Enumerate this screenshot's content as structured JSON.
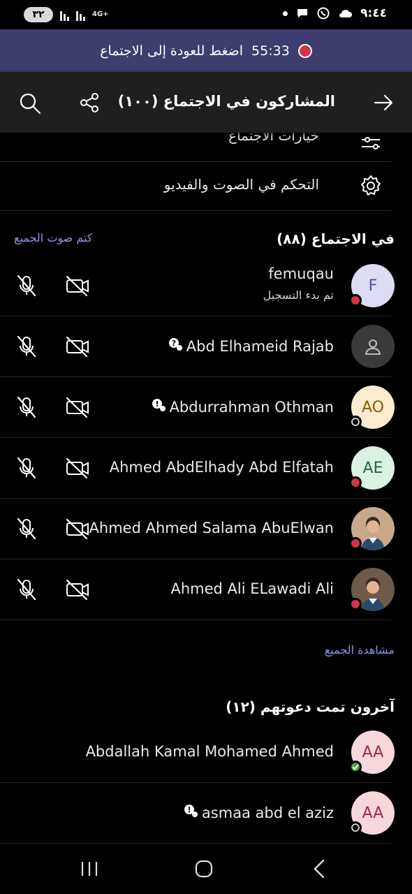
{
  "status_bar": {
    "battery": "٣٢",
    "network": "4G+",
    "time": "٩:٤٤"
  },
  "return_banner": {
    "label": "اضغط للعودة إلى الاجتماع",
    "timer": "55:33",
    "rec_color": "#d1344b"
  },
  "header": {
    "title": "المشاركون في الاجتماع (١٠٠)"
  },
  "options": [
    {
      "label": "خيارات الاجتماع",
      "icon": "meeting-options-icon"
    },
    {
      "label": "التحكم في الصوت والفيديو",
      "icon": "gear-icon"
    }
  ],
  "in_meeting": {
    "title": "في الاجتماع (٨٨)",
    "mute_all": "كتم صوت الجميع",
    "view_all": "مشاهدة الجميع",
    "participants": [
      {
        "name": "femuqau",
        "sub": "تم بدء التسجيل",
        "initials": "F",
        "avatar_bg": "#dcdcf4",
        "avatar_fg": "#4f52b2",
        "presence": "#d1344b",
        "guest": false
      },
      {
        "name": "Abd Elhameid Rajab",
        "initials": "",
        "avatar_bg": "#3a3a3a",
        "avatar_fg": "#bdbdbd",
        "presence": "",
        "guest": true,
        "guest_icon": "guest-unknown-icon"
      },
      {
        "name": "Abdurrahman Othman",
        "initials": "AO",
        "avatar_bg": "#fbeccf",
        "avatar_fg": "#8a5a00",
        "presence": "#000000",
        "guest": true,
        "guest_icon": "guest-warning-icon"
      },
      {
        "name": "Ahmed AbdElhady Abd Elfatah",
        "initials": "AE",
        "avatar_bg": "#d9f2e4",
        "avatar_fg": "#1d6b43",
        "presence": "#d1344b",
        "guest": false
      },
      {
        "name": "Ahmed Ahmed Salama AbuElwan",
        "initials": "",
        "avatar_bg": "#c9a88a",
        "avatar_fg": "#ffffff",
        "presence": "#d1344b",
        "guest": false,
        "photo": true
      },
      {
        "name": "Ahmed Ali ELawadi Ali",
        "initials": "",
        "avatar_bg": "#6d5a48",
        "avatar_fg": "#ffffff",
        "presence": "#d1344b",
        "guest": false,
        "photo": true
      }
    ]
  },
  "invited": {
    "title": "آخرون تمت دعوتهم (١٢)",
    "participants": [
      {
        "name": "Abdallah Kamal Mohamed Ahmed",
        "initials": "AA",
        "avatar_bg": "#f5d7dc",
        "avatar_fg": "#a12a45",
        "presence": "#3fa73f",
        "guest": false
      },
      {
        "name": "asmaa abd el aziz",
        "initials": "AA",
        "avatar_bg": "#f5d7dc",
        "avatar_fg": "#a12a45",
        "presence": "#000000",
        "guest": true,
        "guest_icon": "guest-warning-icon"
      }
    ]
  }
}
